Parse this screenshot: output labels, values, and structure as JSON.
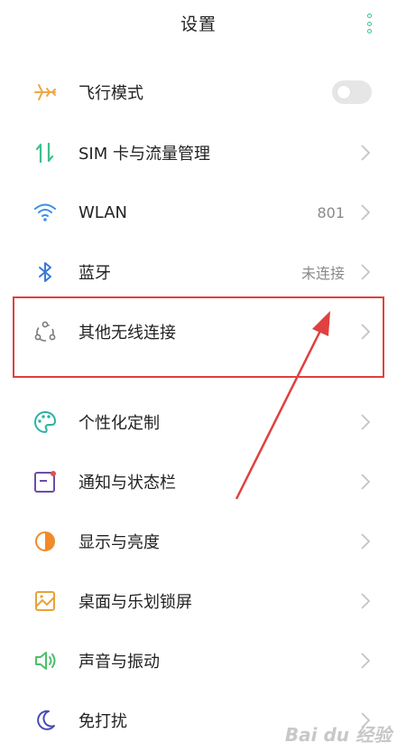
{
  "header": {
    "title": "设置",
    "more_icon": "more-vertical-icon"
  },
  "accent_color": "#3cc08e",
  "annotation_color": "#e04040",
  "rows": [
    {
      "label": "飞行模式",
      "icon": "airplane-icon",
      "control": "toggle",
      "toggle_on": false
    },
    {
      "label": "SIM 卡与流量管理",
      "icon": "sim-data-icon",
      "control": "chevron"
    },
    {
      "label": "WLAN",
      "icon": "wifi-icon",
      "value": "801",
      "control": "chevron"
    },
    {
      "label": "蓝牙",
      "icon": "bluetooth-icon",
      "value": "未连接",
      "control": "chevron"
    },
    {
      "label": "其他无线连接",
      "icon": "other-wireless-icon",
      "control": "chevron",
      "highlighted": true
    },
    {
      "label": "个性化定制",
      "icon": "palette-icon",
      "control": "chevron"
    },
    {
      "label": "通知与状态栏",
      "icon": "notification-icon",
      "control": "chevron"
    },
    {
      "label": "显示与亮度",
      "icon": "brightness-icon",
      "control": "chevron"
    },
    {
      "label": "桌面与乐划锁屏",
      "icon": "wallpaper-icon",
      "control": "chevron"
    },
    {
      "label": "声音与振动",
      "icon": "sound-icon",
      "control": "chevron"
    },
    {
      "label": "免打扰",
      "icon": "moon-icon",
      "control": "chevron"
    }
  ],
  "watermark": "Bai du 经验"
}
